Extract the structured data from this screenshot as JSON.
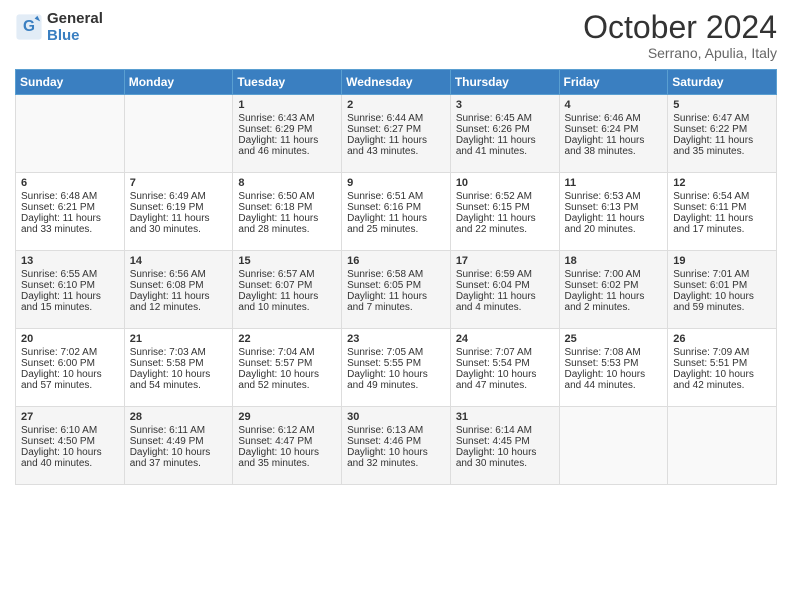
{
  "header": {
    "logo_line1": "General",
    "logo_line2": "Blue",
    "title": "October 2024",
    "subtitle": "Serrano, Apulia, Italy"
  },
  "days_of_week": [
    "Sunday",
    "Monday",
    "Tuesday",
    "Wednesday",
    "Thursday",
    "Friday",
    "Saturday"
  ],
  "weeks": [
    [
      {
        "day": "",
        "sunrise": "",
        "sunset": "",
        "daylight": ""
      },
      {
        "day": "",
        "sunrise": "",
        "sunset": "",
        "daylight": ""
      },
      {
        "day": "1",
        "sunrise": "Sunrise: 6:43 AM",
        "sunset": "Sunset: 6:29 PM",
        "daylight": "Daylight: 11 hours and 46 minutes."
      },
      {
        "day": "2",
        "sunrise": "Sunrise: 6:44 AM",
        "sunset": "Sunset: 6:27 PM",
        "daylight": "Daylight: 11 hours and 43 minutes."
      },
      {
        "day": "3",
        "sunrise": "Sunrise: 6:45 AM",
        "sunset": "Sunset: 6:26 PM",
        "daylight": "Daylight: 11 hours and 41 minutes."
      },
      {
        "day": "4",
        "sunrise": "Sunrise: 6:46 AM",
        "sunset": "Sunset: 6:24 PM",
        "daylight": "Daylight: 11 hours and 38 minutes."
      },
      {
        "day": "5",
        "sunrise": "Sunrise: 6:47 AM",
        "sunset": "Sunset: 6:22 PM",
        "daylight": "Daylight: 11 hours and 35 minutes."
      }
    ],
    [
      {
        "day": "6",
        "sunrise": "Sunrise: 6:48 AM",
        "sunset": "Sunset: 6:21 PM",
        "daylight": "Daylight: 11 hours and 33 minutes."
      },
      {
        "day": "7",
        "sunrise": "Sunrise: 6:49 AM",
        "sunset": "Sunset: 6:19 PM",
        "daylight": "Daylight: 11 hours and 30 minutes."
      },
      {
        "day": "8",
        "sunrise": "Sunrise: 6:50 AM",
        "sunset": "Sunset: 6:18 PM",
        "daylight": "Daylight: 11 hours and 28 minutes."
      },
      {
        "day": "9",
        "sunrise": "Sunrise: 6:51 AM",
        "sunset": "Sunset: 6:16 PM",
        "daylight": "Daylight: 11 hours and 25 minutes."
      },
      {
        "day": "10",
        "sunrise": "Sunrise: 6:52 AM",
        "sunset": "Sunset: 6:15 PM",
        "daylight": "Daylight: 11 hours and 22 minutes."
      },
      {
        "day": "11",
        "sunrise": "Sunrise: 6:53 AM",
        "sunset": "Sunset: 6:13 PM",
        "daylight": "Daylight: 11 hours and 20 minutes."
      },
      {
        "day": "12",
        "sunrise": "Sunrise: 6:54 AM",
        "sunset": "Sunset: 6:11 PM",
        "daylight": "Daylight: 11 hours and 17 minutes."
      }
    ],
    [
      {
        "day": "13",
        "sunrise": "Sunrise: 6:55 AM",
        "sunset": "Sunset: 6:10 PM",
        "daylight": "Daylight: 11 hours and 15 minutes."
      },
      {
        "day": "14",
        "sunrise": "Sunrise: 6:56 AM",
        "sunset": "Sunset: 6:08 PM",
        "daylight": "Daylight: 11 hours and 12 minutes."
      },
      {
        "day": "15",
        "sunrise": "Sunrise: 6:57 AM",
        "sunset": "Sunset: 6:07 PM",
        "daylight": "Daylight: 11 hours and 10 minutes."
      },
      {
        "day": "16",
        "sunrise": "Sunrise: 6:58 AM",
        "sunset": "Sunset: 6:05 PM",
        "daylight": "Daylight: 11 hours and 7 minutes."
      },
      {
        "day": "17",
        "sunrise": "Sunrise: 6:59 AM",
        "sunset": "Sunset: 6:04 PM",
        "daylight": "Daylight: 11 hours and 4 minutes."
      },
      {
        "day": "18",
        "sunrise": "Sunrise: 7:00 AM",
        "sunset": "Sunset: 6:02 PM",
        "daylight": "Daylight: 11 hours and 2 minutes."
      },
      {
        "day": "19",
        "sunrise": "Sunrise: 7:01 AM",
        "sunset": "Sunset: 6:01 PM",
        "daylight": "Daylight: 10 hours and 59 minutes."
      }
    ],
    [
      {
        "day": "20",
        "sunrise": "Sunrise: 7:02 AM",
        "sunset": "Sunset: 6:00 PM",
        "daylight": "Daylight: 10 hours and 57 minutes."
      },
      {
        "day": "21",
        "sunrise": "Sunrise: 7:03 AM",
        "sunset": "Sunset: 5:58 PM",
        "daylight": "Daylight: 10 hours and 54 minutes."
      },
      {
        "day": "22",
        "sunrise": "Sunrise: 7:04 AM",
        "sunset": "Sunset: 5:57 PM",
        "daylight": "Daylight: 10 hours and 52 minutes."
      },
      {
        "day": "23",
        "sunrise": "Sunrise: 7:05 AM",
        "sunset": "Sunset: 5:55 PM",
        "daylight": "Daylight: 10 hours and 49 minutes."
      },
      {
        "day": "24",
        "sunrise": "Sunrise: 7:07 AM",
        "sunset": "Sunset: 5:54 PM",
        "daylight": "Daylight: 10 hours and 47 minutes."
      },
      {
        "day": "25",
        "sunrise": "Sunrise: 7:08 AM",
        "sunset": "Sunset: 5:53 PM",
        "daylight": "Daylight: 10 hours and 44 minutes."
      },
      {
        "day": "26",
        "sunrise": "Sunrise: 7:09 AM",
        "sunset": "Sunset: 5:51 PM",
        "daylight": "Daylight: 10 hours and 42 minutes."
      }
    ],
    [
      {
        "day": "27",
        "sunrise": "Sunrise: 6:10 AM",
        "sunset": "Sunset: 4:50 PM",
        "daylight": "Daylight: 10 hours and 40 minutes."
      },
      {
        "day": "28",
        "sunrise": "Sunrise: 6:11 AM",
        "sunset": "Sunset: 4:49 PM",
        "daylight": "Daylight: 10 hours and 37 minutes."
      },
      {
        "day": "29",
        "sunrise": "Sunrise: 6:12 AM",
        "sunset": "Sunset: 4:47 PM",
        "daylight": "Daylight: 10 hours and 35 minutes."
      },
      {
        "day": "30",
        "sunrise": "Sunrise: 6:13 AM",
        "sunset": "Sunset: 4:46 PM",
        "daylight": "Daylight: 10 hours and 32 minutes."
      },
      {
        "day": "31",
        "sunrise": "Sunrise: 6:14 AM",
        "sunset": "Sunset: 4:45 PM",
        "daylight": "Daylight: 10 hours and 30 minutes."
      },
      {
        "day": "",
        "sunrise": "",
        "sunset": "",
        "daylight": ""
      },
      {
        "day": "",
        "sunrise": "",
        "sunset": "",
        "daylight": ""
      }
    ]
  ]
}
